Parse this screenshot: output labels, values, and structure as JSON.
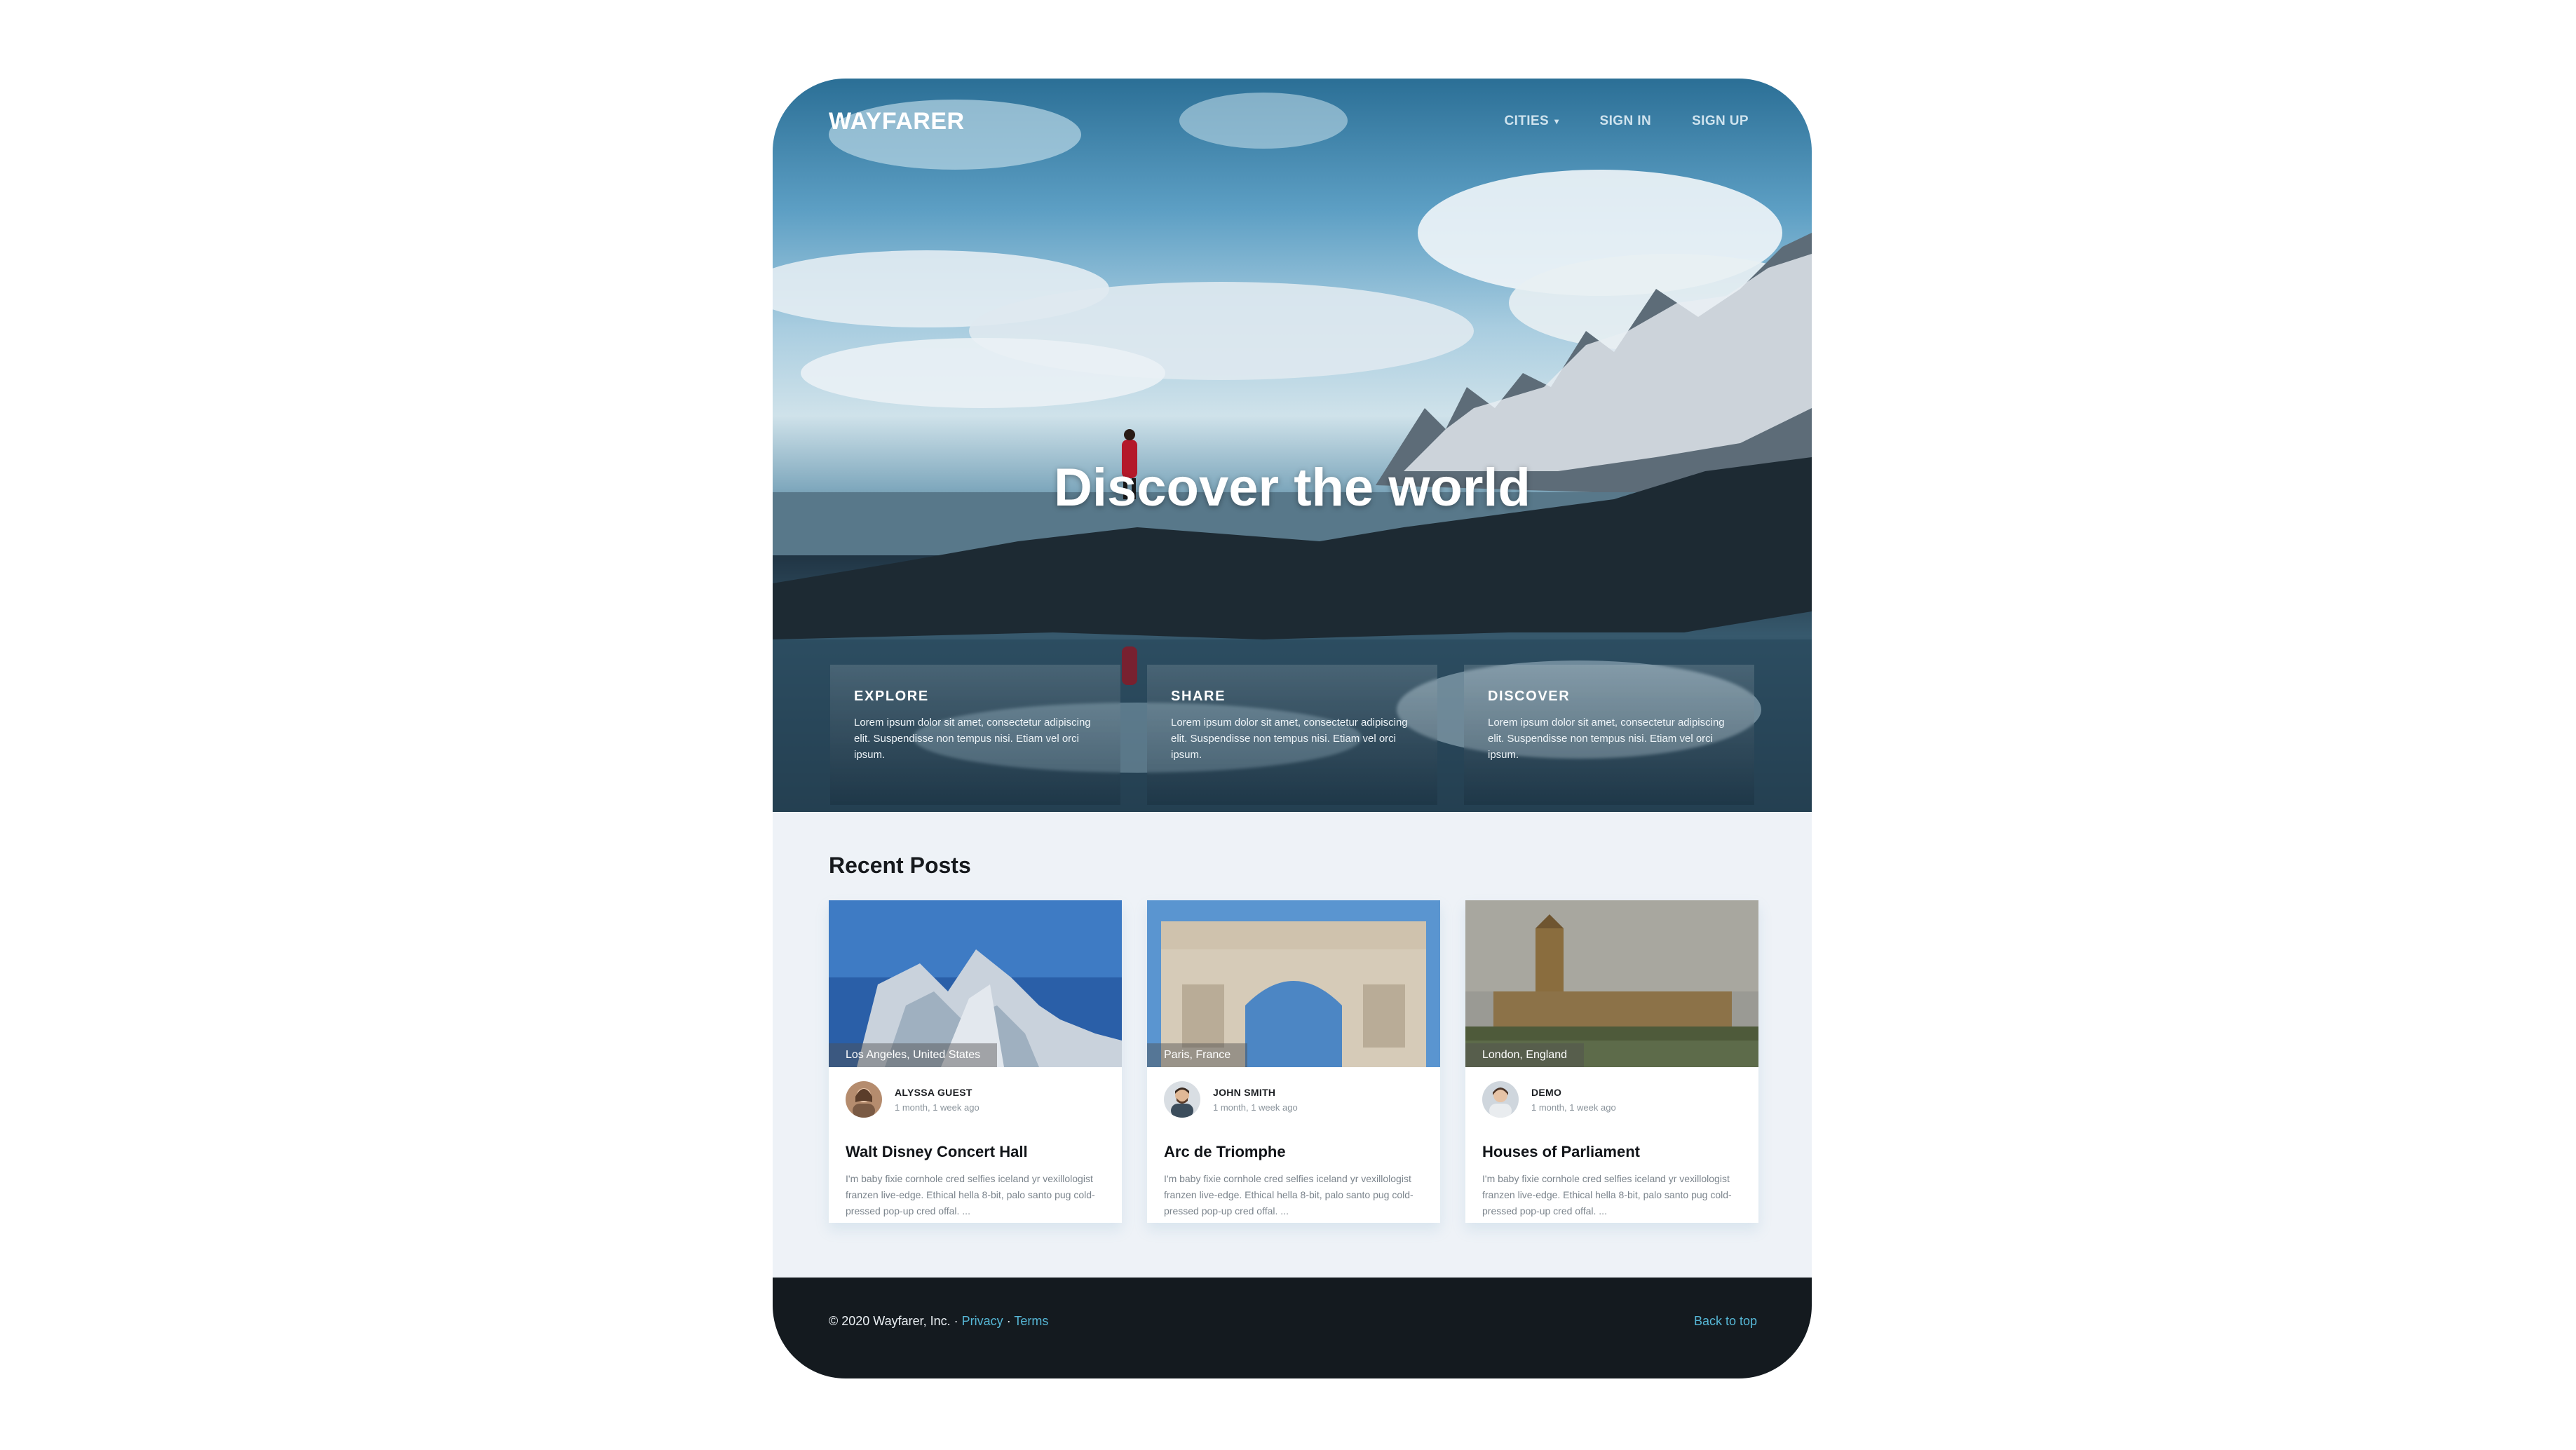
{
  "brand": "WAYFARER",
  "nav": {
    "cities": "CITIES",
    "sign_in": "SIGN IN",
    "sign_up": "SIGN UP"
  },
  "hero": {
    "title": "Discover the world"
  },
  "features": [
    {
      "title": "EXPLORE",
      "text": "Lorem ipsum dolor sit amet, consectetur adipiscing elit. Suspendisse non tempus nisi. Etiam vel orci ipsum."
    },
    {
      "title": "SHARE",
      "text": "Lorem ipsum dolor sit amet, consectetur adipiscing elit. Suspendisse non tempus nisi. Etiam vel orci ipsum."
    },
    {
      "title": "DISCOVER",
      "text": "Lorem ipsum dolor sit amet, consectetur adipiscing elit. Suspendisse non tempus nisi. Etiam vel orci ipsum."
    }
  ],
  "recent": {
    "title": "Recent Posts",
    "posts": [
      {
        "location": "Los Angeles, United States",
        "author": "ALYSSA GUEST",
        "time": "1 month, 1 week ago",
        "title": "Walt Disney Concert Hall",
        "excerpt": "I'm baby fixie cornhole cred selfies iceland yr vexillologist franzen live-edge. Ethical hella 8-bit, palo santo pug cold-pressed pop-up cred offal. ..."
      },
      {
        "location": "Paris, France",
        "author": "JOHN SMITH",
        "time": "1 month, 1 week ago",
        "title": "Arc de Triomphe",
        "excerpt": "I'm baby fixie cornhole cred selfies iceland yr vexillologist franzen live-edge. Ethical hella 8-bit, palo santo pug cold-pressed pop-up cred offal. ..."
      },
      {
        "location": "London, England",
        "author": "DEMO",
        "time": "1 month, 1 week ago",
        "title": "Houses of Parliament",
        "excerpt": "I'm baby fixie cornhole cred selfies iceland yr vexillologist franzen live-edge. Ethical hella 8-bit, palo santo pug cold-pressed pop-up cred offal. ..."
      }
    ]
  },
  "footer": {
    "copyright": "© 2020 Wayfarer, Inc.",
    "sep1": " · ",
    "privacy": "Privacy",
    "sep2": " · ",
    "terms": "Terms",
    "back_to_top": "Back to top"
  },
  "colors": {
    "accent_link": "#56b7d6",
    "footer_bg": "#141a1f",
    "page_bg": "#eef2f7"
  }
}
